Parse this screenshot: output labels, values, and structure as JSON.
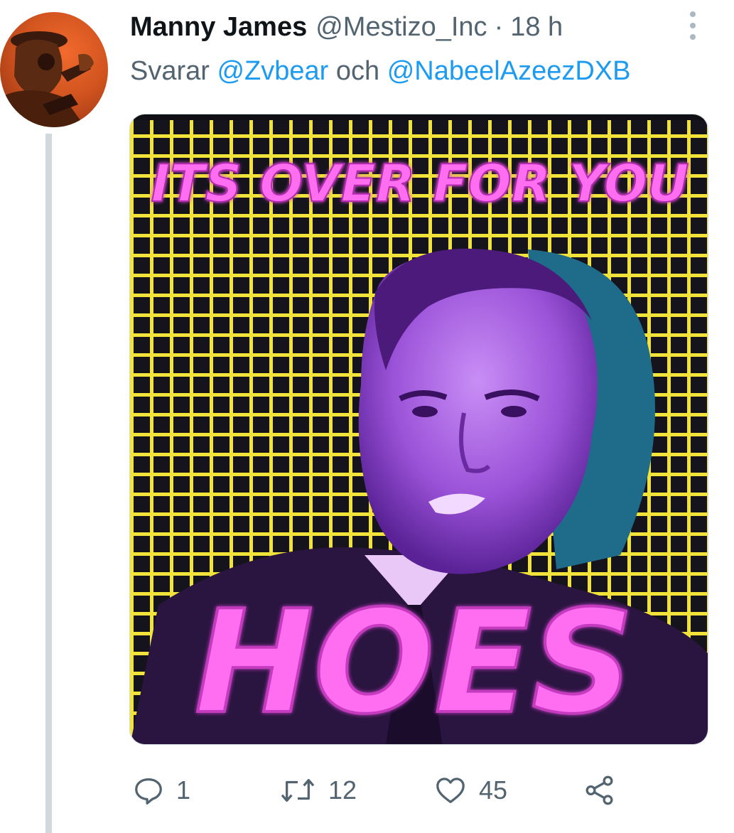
{
  "tweet": {
    "author": {
      "display_name": "Manny James",
      "handle": "@Mestizo_Inc",
      "separator": "·",
      "time": "18 h"
    },
    "reply": {
      "prefix": "Svarar",
      "mention_1": "@Zvbear",
      "conjunction": "och",
      "mention_2": "@NabeelAzeezDXB"
    },
    "media": {
      "top_text": "ITS OVER FOR YOU",
      "bottom_text": "HOES"
    },
    "actions": {
      "reply_count": "1",
      "retweet_count": "12",
      "like_count": "45"
    }
  },
  "colors": {
    "text_primary": "#0f1419",
    "text_secondary": "#536471",
    "link": "#1d9bf0",
    "thread_line": "#cfd9de",
    "meme_text": "#ff6ef0",
    "grid_yellow": "#f2e33a"
  },
  "icons": {
    "more": "more-vertical-icon",
    "reply": "speech-bubble-icon",
    "retweet": "retweet-arrows-icon",
    "like": "heart-icon",
    "share": "share-nodes-icon"
  }
}
